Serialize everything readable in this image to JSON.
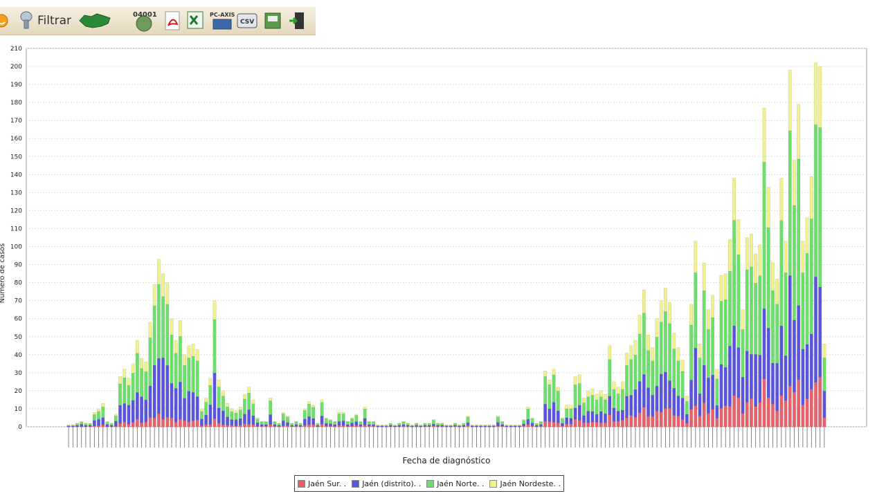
{
  "toolbar": {
    "filter_label": "Filtrar",
    "icons": [
      "home-icon",
      "filter-icon",
      "andalusia-map-icon",
      "municipio-code-icon",
      "pdf-export-icon",
      "excel-export-icon",
      "pc-axis-export-icon",
      "csv-export-icon",
      "print-icon",
      "exit-icon"
    ],
    "code_text": "04001",
    "pcaxis_text": "PC-AXIS",
    "csv_text": "CSV"
  },
  "chart_data": {
    "type": "bar",
    "stacked": true,
    "xlabel": "Fecha de diagnóstico",
    "ylabel": "Número de casos",
    "ylim": [
      0,
      210
    ],
    "yticks": [
      0,
      10,
      20,
      30,
      40,
      50,
      60,
      70,
      80,
      90,
      100,
      110,
      120,
      130,
      140,
      150,
      160,
      170,
      180,
      190,
      200,
      210
    ],
    "grid": true,
    "legend_position": "bottom-center",
    "series": [
      {
        "name": "Jaén Sur. .",
        "color": "#e8606a"
      },
      {
        "name": "Jaén (distrito). .",
        "color": "#5a55e0"
      },
      {
        "name": "Jaén Norte. .",
        "color": "#6be06b"
      },
      {
        "name": "Jaén Nordeste. .",
        "color": "#f0f08c"
      }
    ],
    "approx_totals_segments": [
      [
        0,
        1
      ],
      [
        1,
        1
      ],
      [
        1,
        2
      ],
      [
        1,
        3
      ],
      [
        1,
        2
      ],
      [
        1,
        2
      ],
      [
        1,
        8
      ],
      [
        1,
        10
      ],
      [
        1,
        13
      ],
      [
        1,
        3
      ],
      [
        1,
        2
      ],
      [
        1,
        7
      ],
      [
        1,
        28
      ],
      [
        1,
        32
      ],
      [
        1,
        27
      ],
      [
        1,
        35
      ],
      [
        1,
        48
      ],
      [
        1,
        38
      ],
      [
        1,
        36
      ],
      [
        1,
        58
      ],
      [
        1,
        79
      ],
      [
        1,
        93
      ],
      [
        1,
        85
      ],
      [
        1,
        80
      ],
      [
        1,
        60
      ],
      [
        1,
        48
      ],
      [
        1,
        59
      ],
      [
        1,
        40
      ],
      [
        1,
        45
      ],
      [
        1,
        46
      ],
      [
        1,
        43
      ],
      [
        1,
        10
      ],
      [
        1,
        16
      ],
      [
        1,
        27
      ],
      [
        1,
        70
      ],
      [
        1,
        26
      ],
      [
        1,
        20
      ],
      [
        1,
        13
      ],
      [
        1,
        10
      ],
      [
        1,
        9
      ],
      [
        1,
        11
      ],
      [
        1,
        18
      ],
      [
        1,
        22
      ],
      [
        1,
        15
      ],
      [
        1,
        5
      ],
      [
        1,
        3
      ],
      [
        1,
        3
      ],
      [
        1,
        16
      ],
      [
        1,
        3
      ],
      [
        1,
        2
      ],
      [
        1,
        8
      ],
      [
        1,
        6
      ],
      [
        1,
        2
      ],
      [
        1,
        3
      ],
      [
        1,
        2
      ],
      [
        1,
        10
      ],
      [
        1,
        14
      ],
      [
        1,
        12
      ],
      [
        1,
        2
      ],
      [
        1,
        15
      ],
      [
        1,
        5
      ],
      [
        1,
        4
      ],
      [
        1,
        3
      ],
      [
        1,
        8
      ],
      [
        1,
        8
      ],
      [
        1,
        3
      ],
      [
        1,
        5
      ],
      [
        1,
        7
      ],
      [
        1,
        3
      ],
      [
        1,
        11
      ],
      [
        1,
        3
      ],
      [
        1,
        3
      ],
      [
        1,
        1
      ],
      [
        1,
        1
      ],
      [
        1,
        1
      ],
      [
        1,
        2
      ],
      [
        1,
        1
      ],
      [
        1,
        2
      ],
      [
        1,
        3
      ],
      [
        1,
        2
      ],
      [
        1,
        1
      ],
      [
        1,
        2
      ],
      [
        1,
        1
      ],
      [
        1,
        2
      ],
      [
        1,
        2
      ],
      [
        1,
        4
      ],
      [
        1,
        2
      ],
      [
        1,
        2
      ],
      [
        1,
        1
      ],
      [
        1,
        1
      ],
      [
        1,
        2
      ],
      [
        1,
        1
      ],
      [
        1,
        2
      ],
      [
        1,
        6
      ],
      [
        1,
        1
      ],
      [
        1,
        1
      ],
      [
        1,
        1
      ],
      [
        1,
        1
      ],
      [
        1,
        1
      ],
      [
        1,
        1
      ],
      [
        1,
        6
      ],
      [
        1,
        3
      ],
      [
        1,
        1
      ],
      [
        1,
        1
      ],
      [
        1,
        1
      ],
      [
        1,
        1
      ],
      [
        1,
        4
      ],
      [
        1,
        11
      ],
      [
        1,
        5
      ],
      [
        1,
        2
      ],
      [
        1,
        3
      ],
      [
        1,
        31
      ],
      [
        1,
        26
      ],
      [
        1,
        32
      ],
      [
        1,
        22
      ],
      [
        1,
        5
      ],
      [
        1,
        12
      ],
      [
        1,
        12
      ],
      [
        1,
        28
      ],
      [
        1,
        29
      ],
      [
        1,
        16
      ],
      [
        1,
        20
      ],
      [
        1,
        21
      ],
      [
        1,
        18
      ],
      [
        1,
        20
      ],
      [
        1,
        18
      ],
      [
        1,
        45
      ],
      [
        1,
        25
      ],
      [
        1,
        22
      ],
      [
        1,
        25
      ],
      [
        1,
        41
      ],
      [
        1,
        45
      ],
      [
        1,
        48
      ],
      [
        1,
        62
      ],
      [
        1,
        76
      ],
      [
        1,
        51
      ],
      [
        1,
        44
      ],
      [
        1,
        60
      ],
      [
        1,
        70
      ],
      [
        1,
        77
      ],
      [
        1,
        69
      ],
      [
        1,
        52
      ],
      [
        1,
        44
      ],
      [
        1,
        37
      ],
      [
        1,
        17
      ],
      [
        1,
        68
      ],
      [
        1,
        103
      ],
      [
        1,
        46
      ],
      [
        1,
        91
      ],
      [
        1,
        65
      ],
      [
        1,
        73
      ],
      [
        1,
        32
      ],
      [
        1,
        84
      ],
      [
        1,
        85
      ],
      [
        1,
        104
      ],
      [
        1,
        138
      ],
      [
        1,
        115
      ],
      [
        1,
        65
      ],
      [
        1,
        105
      ],
      [
        1,
        107
      ],
      [
        1,
        96
      ],
      [
        1,
        101
      ],
      [
        1,
        177
      ],
      [
        1,
        133
      ],
      [
        1,
        91
      ],
      [
        1,
        82
      ],
      [
        1,
        138
      ],
      [
        1,
        103
      ],
      [
        1,
        198
      ],
      [
        1,
        148
      ],
      [
        1,
        179
      ],
      [
        1,
        103
      ],
      [
        1,
        116
      ],
      [
        1,
        139
      ],
      [
        1,
        202
      ],
      [
        1,
        200
      ],
      [
        1,
        46
      ]
    ]
  },
  "legend_labels": [
    "Jaén Sur. .",
    "Jaén (distrito). .",
    "Jaén Norte. .",
    "Jaén Nordeste. ."
  ]
}
